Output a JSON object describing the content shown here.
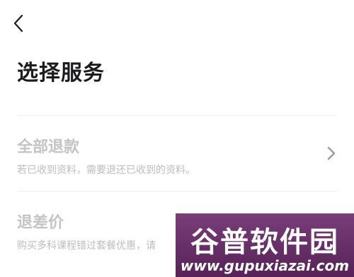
{
  "header": {
    "back_icon": "chevron-left-icon",
    "title": "选择服务"
  },
  "options": [
    {
      "title": "全部退款",
      "description": "若已收到资料，需要退还已收到的资料。",
      "icon": "chevron-right-icon"
    },
    {
      "title": "退差价",
      "description": "购买多科课程错过套餐优惠，请"
    }
  ],
  "watermark": {
    "brand": "谷普软件园",
    "url": "www.gupuxiazai.com"
  },
  "colors": {
    "title": "#1c1c1e",
    "option_text": "#c4c4c6",
    "divider": "#efefef",
    "chevron": "#9a9a9c"
  }
}
